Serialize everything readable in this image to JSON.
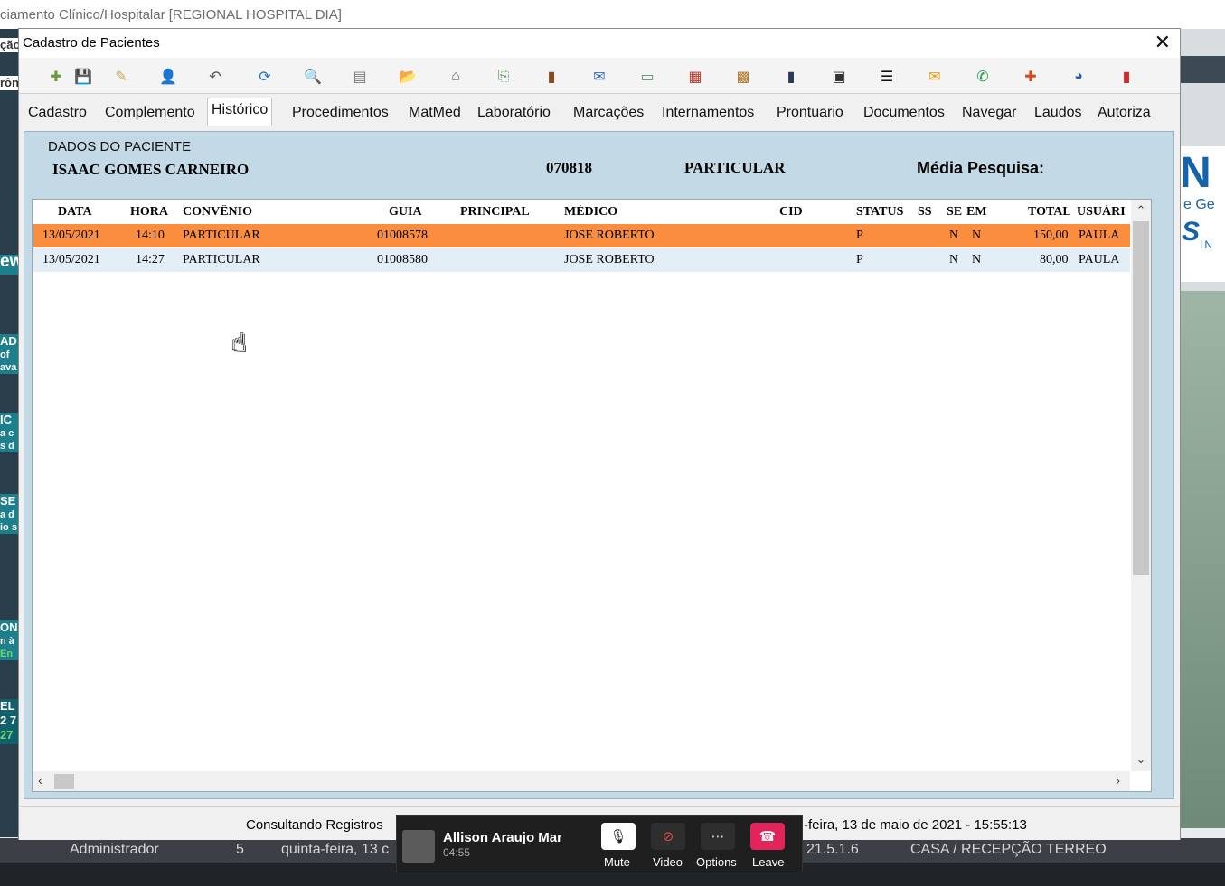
{
  "background": {
    "app_title": "ciamento Clínico/Hospitalar [REGIONAL HOSPITAL DIA]",
    "left_fragments": [
      "ção",
      "rôn",
      "ew",
      "AD",
      "of",
      "ava",
      "IC",
      "a c",
      "s d",
      "SE",
      "a d",
      "io s",
      "ON",
      "n à",
      "En",
      "EL",
      "2 7",
      "27"
    ],
    "right_fragments": [
      "N",
      "e Ge",
      "S",
      "IN"
    ]
  },
  "window": {
    "title": "Cadastro de Pacientes",
    "close_label": "✕"
  },
  "toolbar": {
    "icons": [
      {
        "name": "new-record-icon",
        "glyph": "✚",
        "color": "#6a9a3c"
      },
      {
        "name": "save-icon",
        "glyph": "💾",
        "color": "#444444"
      },
      {
        "name": "edit-icon",
        "glyph": "✎",
        "color": "#c8a25a"
      },
      {
        "name": "user-icon",
        "glyph": "👤",
        "color": "#8a5a3c"
      },
      {
        "name": "undo-icon",
        "glyph": "↶",
        "color": "#555555"
      },
      {
        "name": "refresh-icon",
        "glyph": "⟳",
        "color": "#2a6fc9"
      },
      {
        "name": "search-icon",
        "glyph": "🔍",
        "color": "#1f5fa8"
      },
      {
        "name": "document-icon",
        "glyph": "▤",
        "color": "#777777"
      },
      {
        "name": "folder-icon",
        "glyph": "📂",
        "color": "#d9a521"
      },
      {
        "name": "home-icon",
        "glyph": "⌂",
        "color": "#666666"
      },
      {
        "name": "attach-icon",
        "glyph": "⎘",
        "color": "#5a9a5a"
      },
      {
        "name": "book-icon",
        "glyph": "▮",
        "color": "#8a4a1c"
      },
      {
        "name": "mail-send-icon",
        "glyph": "✉",
        "color": "#3a6ab0"
      },
      {
        "name": "card-icon",
        "glyph": "▭",
        "color": "#4a9a6a"
      },
      {
        "name": "report-icon",
        "glyph": "▦",
        "color": "#c0392b"
      },
      {
        "name": "colors-icon",
        "glyph": "▩",
        "color": "#b07a2a"
      },
      {
        "name": "notebook-icon",
        "glyph": "▮",
        "color": "#2a3a5a"
      },
      {
        "name": "film-icon",
        "glyph": "▣",
        "color": "#333333"
      },
      {
        "name": "list-icon",
        "glyph": "☰",
        "color": "#111111"
      },
      {
        "name": "envelope-icon",
        "glyph": "✉",
        "color": "#e0a020"
      },
      {
        "name": "whatsapp-icon",
        "glyph": "✆",
        "color": "#1a9a3a"
      },
      {
        "name": "medical-cross-icon",
        "glyph": "✚",
        "color": "#d64a1a"
      },
      {
        "name": "pie-chart-icon",
        "glyph": "◕",
        "color": "#2a5aa8"
      },
      {
        "name": "exit-door-icon",
        "glyph": "▮",
        "color": "#d62a2a"
      }
    ]
  },
  "tabs": [
    "Cadastro",
    "Complemento",
    "Histórico",
    "Procedimentos",
    "MatMed",
    "Laboratório",
    "Marcações",
    "Internamentos",
    "Prontuario",
    "Documentos",
    "Navegar",
    "Laudos",
    "Autoriza"
  ],
  "patient": {
    "label": "DADOS DO PACIENTE",
    "name": "ISAAC GOMES CARNEIRO",
    "code": "070818",
    "insurance": "PARTICULAR",
    "media_label": "Média Pesquisa:"
  },
  "grid": {
    "headers": [
      "DATA",
      "HORA",
      "CONVÊNIO",
      "GUIA",
      "PRINCIPAL",
      "MÉDICO",
      "CID",
      "STATUS",
      "SS",
      "SE",
      "EM",
      "TOTAL",
      "USUÁRI"
    ],
    "rows": [
      {
        "data": "13/05/2021",
        "hora": "14:10",
        "convenio": "PARTICULAR",
        "guia": "01008578",
        "principal": "",
        "medico": "JOSE ROBERTO",
        "cid": "",
        "status": "P",
        "ss": "",
        "se": "N",
        "em": "N",
        "total": "150,00",
        "usuario": "PAULA"
      },
      {
        "data": "13/05/2021",
        "hora": "14:27",
        "convenio": "PARTICULAR",
        "guia": "01008580",
        "principal": "",
        "medico": "JOSE ROBERTO",
        "cid": "",
        "status": "P",
        "ss": "",
        "se": "N",
        "em": "N",
        "total": "80,00",
        "usuario": "PAULA"
      }
    ]
  },
  "statusbar": {
    "message": "Consultando Registros",
    "datetime": "-feira, 13 de maio de 2021  -  15:55:13"
  },
  "bottombar": {
    "user": "Administrador",
    "num": "5",
    "date": "quinta-feira, 13 c",
    "version": "21.5.1.6",
    "location": "CASA / RECEPÇÃO TERREO"
  },
  "call": {
    "name": "Allison Araujo Marc",
    "time": "04:55",
    "mute_label": "Mute",
    "video_label": "Video",
    "options_label": "Options",
    "leave_label": "Leave",
    "leave_color": "#e3245a"
  }
}
